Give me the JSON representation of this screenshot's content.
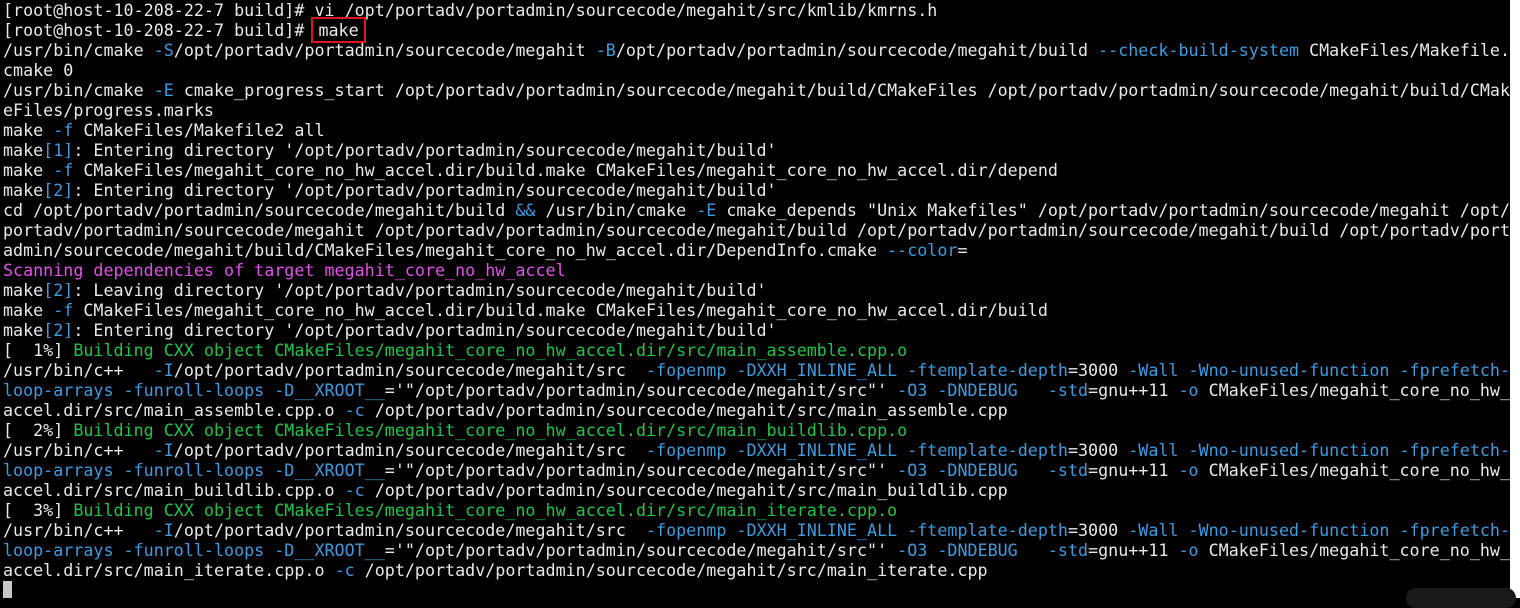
{
  "terminal": {
    "colors": {
      "background": "#000000",
      "default": "#e8e8e8",
      "blue": "#3f9bdd",
      "green": "#1ec44a",
      "magenta": "#e052e6",
      "highlight_box": "#e0141b"
    },
    "lines": [
      [
        {
          "t": "[root@host-10-208-22-7 build]# vi /opt/portadv/portadmin/sourcecode/megahit/src/kmlib/kmrns.h",
          "c": "default"
        }
      ],
      [
        {
          "t": "[root@host-10-208-22-7 build]# ",
          "c": "default"
        },
        {
          "t": "make",
          "c": "default",
          "boxed": true
        }
      ],
      [
        {
          "t": "/usr/bin/cmake ",
          "c": "default"
        },
        {
          "t": "-S",
          "c": "blue"
        },
        {
          "t": "/opt/portadv/portadmin/sourcecode/megahit ",
          "c": "default"
        },
        {
          "t": "-B",
          "c": "blue"
        },
        {
          "t": "/opt/portadv/portadmin/sourcecode/megahit/build ",
          "c": "default"
        },
        {
          "t": "--check-build-system",
          "c": "blue"
        },
        {
          "t": " CMakeFiles/Makefile.",
          "c": "default"
        }
      ],
      [
        {
          "t": "cmake 0",
          "c": "default"
        }
      ],
      [
        {
          "t": "/usr/bin/cmake ",
          "c": "default"
        },
        {
          "t": "-E",
          "c": "blue"
        },
        {
          "t": " cmake_progress_start /opt/portadv/portadmin/sourcecode/megahit/build/CMakeFiles /opt/portadv/portadmin/sourcecode/megahit/build/CMak",
          "c": "default"
        }
      ],
      [
        {
          "t": "eFiles/progress.marks",
          "c": "default"
        }
      ],
      [
        {
          "t": "make ",
          "c": "default"
        },
        {
          "t": "-f",
          "c": "blue"
        },
        {
          "t": " CMakeFiles/Makefile2 all",
          "c": "default"
        }
      ],
      [
        {
          "t": "make",
          "c": "default"
        },
        {
          "t": "[1]",
          "c": "blue"
        },
        {
          "t": ": Entering directory '/opt/portadv/portadmin/sourcecode/megahit/build'",
          "c": "default"
        }
      ],
      [
        {
          "t": "make ",
          "c": "default"
        },
        {
          "t": "-f",
          "c": "blue"
        },
        {
          "t": " CMakeFiles/megahit_core_no_hw_accel.dir/build.make CMakeFiles/megahit_core_no_hw_accel.dir/depend",
          "c": "default"
        }
      ],
      [
        {
          "t": "make",
          "c": "default"
        },
        {
          "t": "[2]",
          "c": "blue"
        },
        {
          "t": ": Entering directory '/opt/portadv/portadmin/sourcecode/megahit/build'",
          "c": "default"
        }
      ],
      [
        {
          "t": "cd /opt/portadv/portadmin/sourcecode/megahit/build ",
          "c": "default"
        },
        {
          "t": "&&",
          "c": "blue"
        },
        {
          "t": " /usr/bin/cmake ",
          "c": "default"
        },
        {
          "t": "-E",
          "c": "blue"
        },
        {
          "t": " cmake_depends \"Unix Makefiles\" /opt/portadv/portadmin/sourcecode/megahit /opt/",
          "c": "default"
        }
      ],
      [
        {
          "t": "portadv/portadmin/sourcecode/megahit /opt/portadv/portadmin/sourcecode/megahit/build /opt/portadv/portadmin/sourcecode/megahit/build /opt/portadv/port",
          "c": "default"
        }
      ],
      [
        {
          "t": "admin/sourcecode/megahit/build/CMakeFiles/megahit_core_no_hw_accel.dir/DependInfo.cmake ",
          "c": "default"
        },
        {
          "t": "--color",
          "c": "blue"
        },
        {
          "t": "=",
          "c": "default"
        }
      ],
      [
        {
          "t": "Scanning dependencies of target megahit_core_no_hw_accel",
          "c": "magenta"
        }
      ],
      [
        {
          "t": "make",
          "c": "default"
        },
        {
          "t": "[2]",
          "c": "blue"
        },
        {
          "t": ": Leaving directory '/opt/portadv/portadmin/sourcecode/megahit/build'",
          "c": "default"
        }
      ],
      [
        {
          "t": "make ",
          "c": "default"
        },
        {
          "t": "-f",
          "c": "blue"
        },
        {
          "t": " CMakeFiles/megahit_core_no_hw_accel.dir/build.make CMakeFiles/megahit_core_no_hw_accel.dir/build",
          "c": "default"
        }
      ],
      [
        {
          "t": "make",
          "c": "default"
        },
        {
          "t": "[2]",
          "c": "blue"
        },
        {
          "t": ": Entering directory '/opt/portadv/portadmin/sourcecode/megahit/build'",
          "c": "default"
        }
      ],
      [
        {
          "t": "[  1%] ",
          "c": "default"
        },
        {
          "t": "Building CXX object CMakeFiles/megahit_core_no_hw_accel.dir/src/main_assemble.cpp.o",
          "c": "green"
        }
      ],
      [
        {
          "t": "/usr/bin/c++   ",
          "c": "default"
        },
        {
          "t": "-I",
          "c": "blue"
        },
        {
          "t": "/opt/portadv/portadmin/sourcecode/megahit/src  ",
          "c": "default"
        },
        {
          "t": "-fopenmp -DXXH_INLINE_ALL -ftemplate-depth",
          "c": "blue"
        },
        {
          "t": "=3000 ",
          "c": "default"
        },
        {
          "t": "-Wall -Wno-unused-function -fprefetch-",
          "c": "blue"
        }
      ],
      [
        {
          "t": "loop-arrays -funroll-loops -D__XROOT__",
          "c": "blue"
        },
        {
          "t": "='\"/opt/portadv/portadmin/sourcecode/megahit/src\"' ",
          "c": "default"
        },
        {
          "t": "-O3 -DNDEBUG",
          "c": "blue"
        },
        {
          "t": "   ",
          "c": "default"
        },
        {
          "t": "-std",
          "c": "blue"
        },
        {
          "t": "=gnu++11 ",
          "c": "default"
        },
        {
          "t": "-o",
          "c": "blue"
        },
        {
          "t": " CMakeFiles/megahit_core_no_hw_",
          "c": "default"
        }
      ],
      [
        {
          "t": "accel.dir/src/main_assemble.cpp.o ",
          "c": "default"
        },
        {
          "t": "-c",
          "c": "blue"
        },
        {
          "t": " /opt/portadv/portadmin/sourcecode/megahit/src/main_assemble.cpp",
          "c": "default"
        }
      ],
      [
        {
          "t": "[  2%] ",
          "c": "default"
        },
        {
          "t": "Building CXX object CMakeFiles/megahit_core_no_hw_accel.dir/src/main_buildlib.cpp.o",
          "c": "green"
        }
      ],
      [
        {
          "t": "/usr/bin/c++   ",
          "c": "default"
        },
        {
          "t": "-I",
          "c": "blue"
        },
        {
          "t": "/opt/portadv/portadmin/sourcecode/megahit/src  ",
          "c": "default"
        },
        {
          "t": "-fopenmp -DXXH_INLINE_ALL -ftemplate-depth",
          "c": "blue"
        },
        {
          "t": "=3000 ",
          "c": "default"
        },
        {
          "t": "-Wall -Wno-unused-function -fprefetch-",
          "c": "blue"
        }
      ],
      [
        {
          "t": "loop-arrays -funroll-loops -D__XROOT__",
          "c": "blue"
        },
        {
          "t": "='\"/opt/portadv/portadmin/sourcecode/megahit/src\"' ",
          "c": "default"
        },
        {
          "t": "-O3 -DNDEBUG",
          "c": "blue"
        },
        {
          "t": "   ",
          "c": "default"
        },
        {
          "t": "-std",
          "c": "blue"
        },
        {
          "t": "=gnu++11 ",
          "c": "default"
        },
        {
          "t": "-o",
          "c": "blue"
        },
        {
          "t": " CMakeFiles/megahit_core_no_hw_",
          "c": "default"
        }
      ],
      [
        {
          "t": "accel.dir/src/main_buildlib.cpp.o ",
          "c": "default"
        },
        {
          "t": "-c",
          "c": "blue"
        },
        {
          "t": " /opt/portadv/portadmin/sourcecode/megahit/src/main_buildlib.cpp",
          "c": "default"
        }
      ],
      [
        {
          "t": "[  3%] ",
          "c": "default"
        },
        {
          "t": "Building CXX object CMakeFiles/megahit_core_no_hw_accel.dir/src/main_iterate.cpp.o",
          "c": "green"
        }
      ],
      [
        {
          "t": "/usr/bin/c++   ",
          "c": "default"
        },
        {
          "t": "-I",
          "c": "blue"
        },
        {
          "t": "/opt/portadv/portadmin/sourcecode/megahit/src  ",
          "c": "default"
        },
        {
          "t": "-fopenmp -DXXH_INLINE_ALL -ftemplate-depth",
          "c": "blue"
        },
        {
          "t": "=3000 ",
          "c": "default"
        },
        {
          "t": "-Wall -Wno-unused-function -fprefetch-",
          "c": "blue"
        }
      ],
      [
        {
          "t": "loop-arrays -funroll-loops -D__XROOT__",
          "c": "blue"
        },
        {
          "t": "='\"/opt/portadv/portadmin/sourcecode/megahit/src\"' ",
          "c": "default"
        },
        {
          "t": "-O3 -DNDEBUG",
          "c": "blue"
        },
        {
          "t": "   ",
          "c": "default"
        },
        {
          "t": "-std",
          "c": "blue"
        },
        {
          "t": "=gnu++11 ",
          "c": "default"
        },
        {
          "t": "-o",
          "c": "blue"
        },
        {
          "t": " CMakeFiles/megahit_core_no_hw_",
          "c": "default"
        }
      ],
      [
        {
          "t": "accel.dir/src/main_iterate.cpp.o ",
          "c": "default"
        },
        {
          "t": "-c",
          "c": "blue"
        },
        {
          "t": " /opt/portadv/portadmin/sourcecode/megahit/src/main_iterate.cpp",
          "c": "default"
        }
      ]
    ]
  }
}
